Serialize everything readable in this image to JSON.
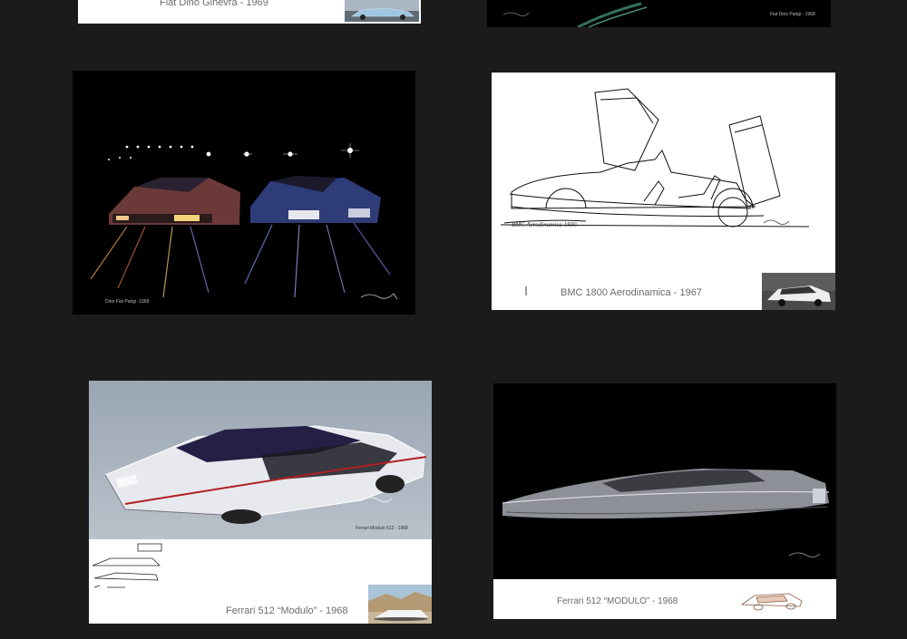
{
  "cards": {
    "fiat_dino_ginevra": {
      "caption": "Fiat Dino Ginevra - 1969"
    },
    "fiat_dino_parigi": {
      "caption": "Fiat Dino Parigi - 1968"
    },
    "dino_fiat_parigi": {
      "caption": "Dino Fiat Parigi -1968"
    },
    "bmc_1800": {
      "caption": "BMC 1800 Aerodinamica - 1967",
      "sketch_note": "BMC Aerodinamica 1800"
    },
    "ferrari_512_modulo_color": {
      "caption": "Ferrari 512  “Modulo” - 1968",
      "sketch_note": "Ferrari Modulo 512 - 1968"
    },
    "ferrari_512_modulo_dark": {
      "caption": "Ferrari 512 “MODULO” - 1968"
    }
  },
  "colors": {
    "page_bg": "#1b1b1b",
    "card_white": "#ffffff",
    "card_black": "#000000",
    "caption_text": "#6a6a6a",
    "modulo_stripe": "#b02020"
  }
}
